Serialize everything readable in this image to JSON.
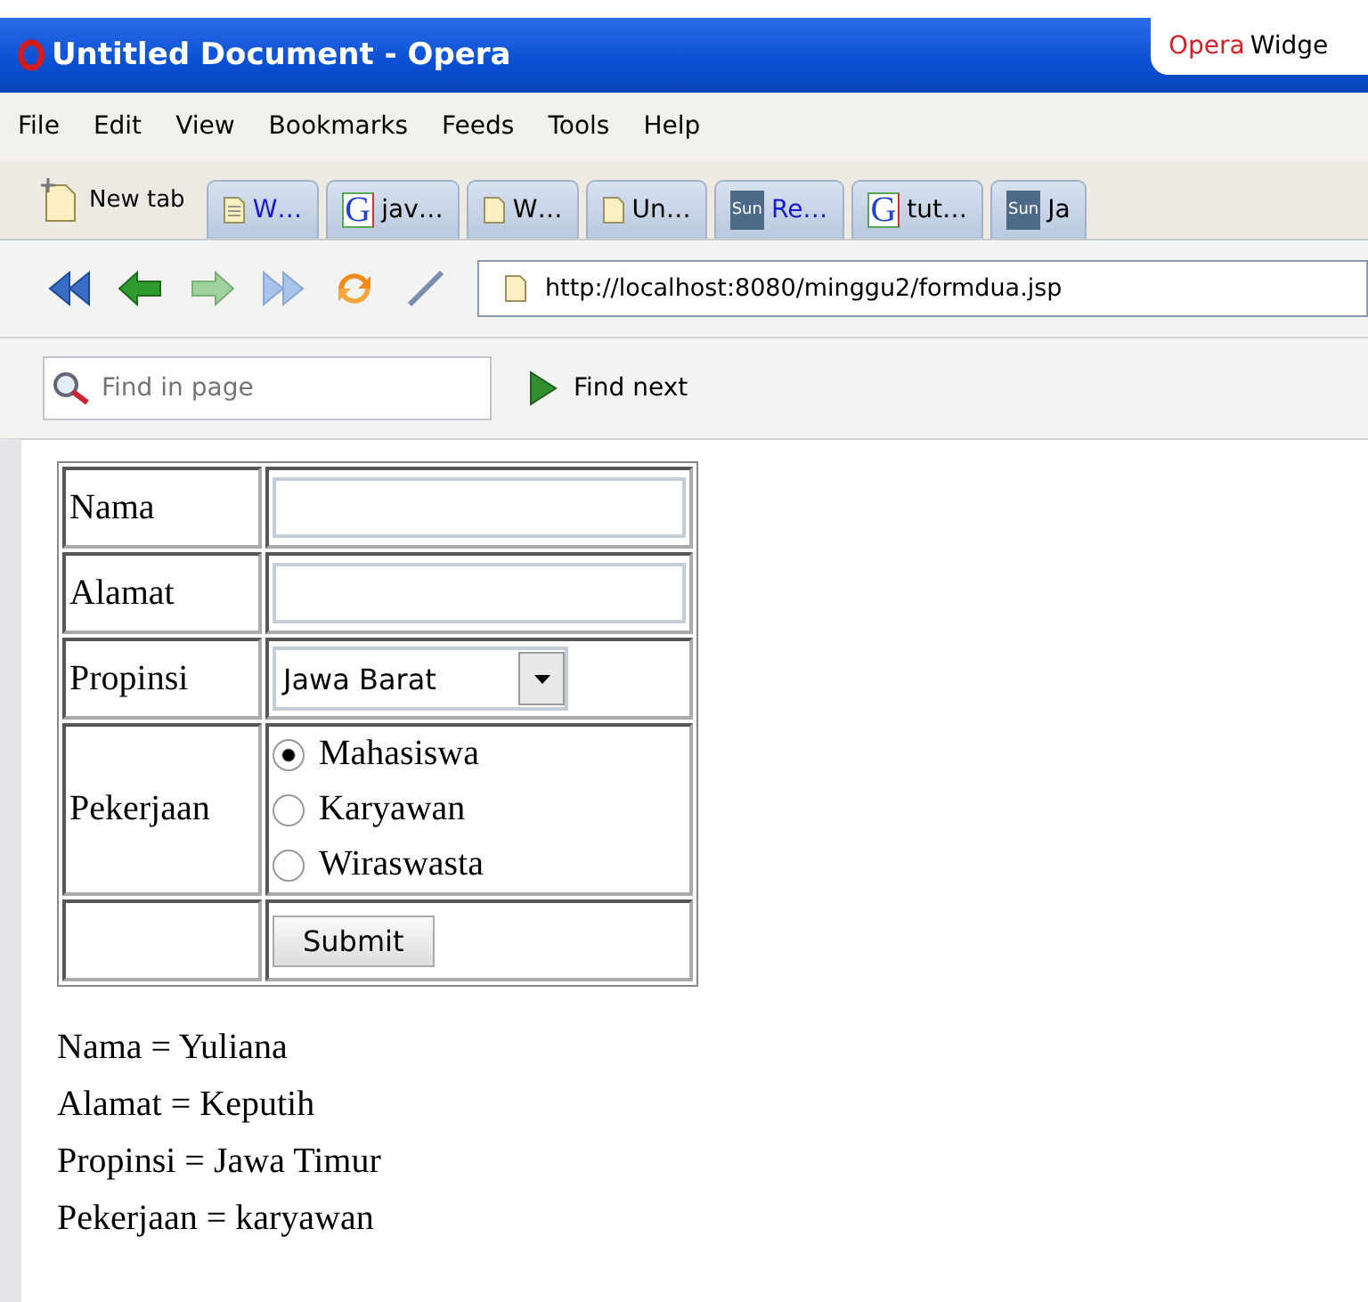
{
  "window": {
    "title": "Untitled Document - Opera",
    "widget_label": {
      "brand": "Opera",
      "rest": "Widge"
    }
  },
  "menu": [
    "File",
    "Edit",
    "View",
    "Bookmarks",
    "Feeds",
    "Tools",
    "Help"
  ],
  "new_tab": {
    "label": "New tab"
  },
  "tabs": [
    {
      "kind": "text-doc",
      "label": "W…",
      "blue": true
    },
    {
      "kind": "letter",
      "icon_text": "G",
      "label": "jav…",
      "blue": false
    },
    {
      "kind": "doc",
      "label": "W…",
      "blue": false
    },
    {
      "kind": "doc",
      "label": "Un…",
      "blue": false
    },
    {
      "kind": "letter-dark",
      "icon_text": "Sun",
      "label": "Re…",
      "blue": true
    },
    {
      "kind": "letter",
      "icon_text": "G",
      "label": "tut…",
      "blue": false
    },
    {
      "kind": "letter-dark",
      "icon_text": "Sun",
      "label": "Ja",
      "blue": false
    }
  ],
  "toolbar": {
    "address": "http://localhost:8080/minggu2/formdua.jsp"
  },
  "find_bar": {
    "placeholder": "Find in page",
    "button": "Find next"
  },
  "form": {
    "rows": [
      {
        "kind": "text",
        "label": "Nama"
      },
      {
        "kind": "text",
        "label": "Alamat"
      },
      {
        "kind": "select",
        "label": "Propinsi",
        "value": "Jawa Barat"
      },
      {
        "kind": "radio",
        "label": "Pekerjaan",
        "options": [
          {
            "label": "Mahasiswa",
            "selected": true
          },
          {
            "label": "Karyawan",
            "selected": false
          },
          {
            "label": "Wiraswasta",
            "selected": false
          }
        ]
      },
      {
        "kind": "submit",
        "button": "Submit"
      }
    ]
  },
  "result": [
    "Nama = Yuliana",
    "Alamat = Keputih",
    "Propinsi = Jawa Timur",
    "Pekerjaan = karyawan"
  ]
}
